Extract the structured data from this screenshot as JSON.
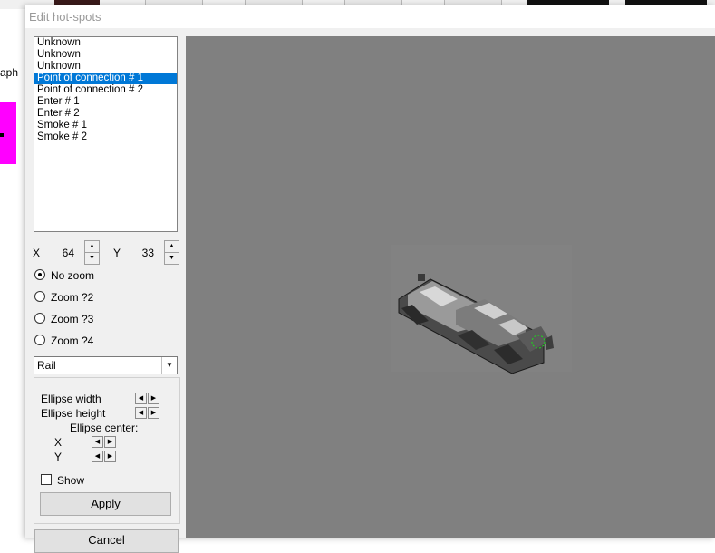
{
  "background": {
    "partial_text": "aph"
  },
  "dialog": {
    "title": "Edit hot-spots",
    "hotspot_list": {
      "items": [
        "Unknown",
        "Unknown",
        "Unknown",
        "Point of connection # 1",
        "Point of connection # 2",
        "Enter # 1",
        "Enter # 2",
        "Smoke # 1",
        "Smoke # 2"
      ],
      "selected_index": 3
    },
    "coords": {
      "x_label": "X",
      "x_value": "64",
      "y_label": "Y",
      "y_value": "33"
    },
    "zoom": {
      "options": [
        "No zoom",
        "Zoom ?2",
        "Zoom ?3",
        "Zoom ?4"
      ],
      "selected_index": 0
    },
    "type_select": {
      "value": "Rail"
    },
    "ellipse": {
      "width_label": "Ellipse width",
      "height_label": "Ellipse height",
      "center_label": "Ellipse center:",
      "x_label": "X",
      "y_label": "Y",
      "show_label": "Show",
      "show_checked": false
    },
    "apply_label": "Apply",
    "cancel_label": "Cancel"
  },
  "colors": {
    "selection": "#0078d7",
    "preview_bg": "#808080",
    "hotspot_marker": "#22cc22",
    "magenta_block": "#ff00ff"
  }
}
